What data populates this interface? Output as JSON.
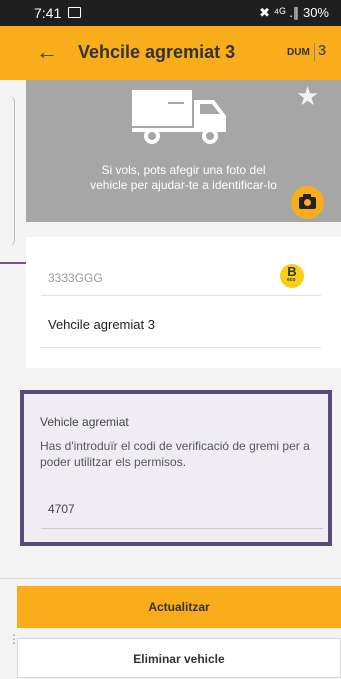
{
  "status_bar": {
    "time": "7:41",
    "right": "✖ ⁴ᴳ .∥ 30%"
  },
  "header": {
    "back_icon": "arrow-left-icon",
    "title": "Vehcile agremiat 3",
    "dum_label": "DUM",
    "walk_icon": "pedestrian-icon"
  },
  "photo_area": {
    "vehicle_icon": "truck-icon",
    "favorite_icon": "star-icon",
    "hint_line1": "Si vols, pots afegir una foto del",
    "hint_line2": "vehicle per ajudar-te a identificar-lo",
    "camera_icon": "camera-icon"
  },
  "vehicle_form": {
    "plate": "3333GGG",
    "badge_letter": "B",
    "badge_sub": "eco",
    "name": "Vehcile agremiat 3"
  },
  "verification": {
    "heading": "Vehicle agremiat",
    "description": "Has d'introduïr el codi de verificació de gremi per a poder utilitzar els permisos.",
    "code": "4707"
  },
  "actions": {
    "update_label": "Actualitzar",
    "delete_label": "Eliminar vehicle"
  },
  "colors": {
    "accent": "#f9ad1b",
    "verify_border": "#5a4a78",
    "photo_bg": "#a6a6a6"
  }
}
